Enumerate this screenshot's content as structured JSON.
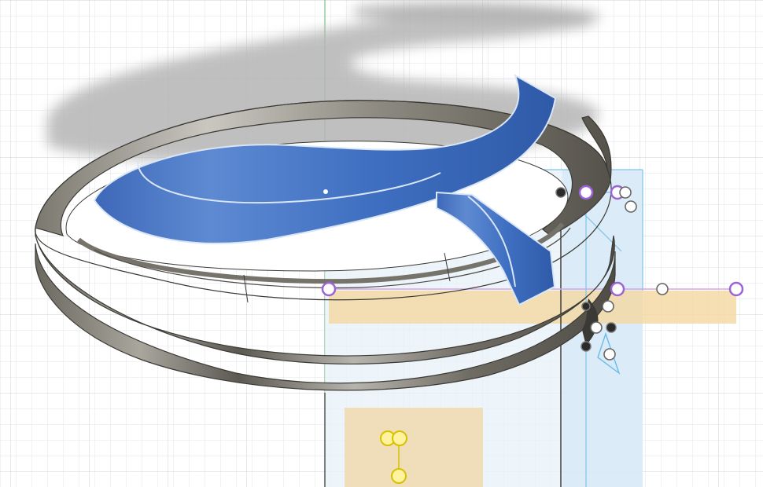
{
  "viewport": {
    "kind": "cad-3d-viewport",
    "background_color": "#ffffff",
    "grid_color": "#d9dde2",
    "grid_major_color": "#c9ced5"
  },
  "colors": {
    "selected_face": "#3f6fc1",
    "selected_face_light": "#6a93d8",
    "metal_dark": "#5a5750",
    "metal_mid": "#8f8b82",
    "metal_light": "#c9c7c0",
    "shadow": "#b9b9b9",
    "sketch_plane_blue": "#cfe5f5",
    "sketch_plane_orange": "#f3d9a6",
    "sketch_line": "#5cb6e6",
    "constraint_purple": "#9c63d6",
    "constraint_yellow": "#d7c100",
    "axis_green": "#4caf50"
  },
  "icons": {
    "sketch_point": "hollow-circle",
    "constraint_point": "purple-circle",
    "fixed_point": "filled-black-circle",
    "coincident": "yellow-double-circle"
  }
}
